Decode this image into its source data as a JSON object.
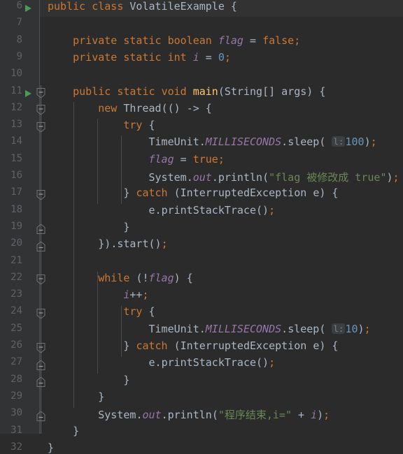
{
  "editor": {
    "language": "Java",
    "theme": "Darcula",
    "colors": {
      "background": "#2B2B2B",
      "gutter_background": "#313335",
      "gutter_border": "#4E5254",
      "line_number": "#606366",
      "caret_line": "#323232",
      "default_text": "#A9B7C6",
      "keyword": "#CC7832",
      "string": "#6A8759",
      "number": "#6897BB",
      "method": "#FFC66D",
      "static_field": "#9876AA",
      "run_marker": "#499C54",
      "indent_guide": "#4B4B4B",
      "inlay_hint_bg": "#3B3F41",
      "inlay_hint_text": "#7A7F82"
    },
    "first_visible_line": 6,
    "last_visible_line": 32
  },
  "gutter": {
    "line_numbers": [
      6,
      7,
      8,
      9,
      10,
      11,
      12,
      13,
      14,
      15,
      16,
      17,
      18,
      19,
      20,
      21,
      22,
      23,
      24,
      25,
      26,
      27,
      28,
      29,
      30,
      31,
      32
    ],
    "run_markers": [
      6,
      11
    ],
    "fold_markers": [
      {
        "line": 11,
        "direction": "down"
      },
      {
        "line": 12,
        "direction": "down"
      },
      {
        "line": 13,
        "direction": "down"
      },
      {
        "line": 17,
        "direction": "down"
      },
      {
        "line": 19,
        "direction": "up"
      },
      {
        "line": 20,
        "direction": "up"
      },
      {
        "line": 22,
        "direction": "down"
      },
      {
        "line": 24,
        "direction": "down"
      },
      {
        "line": 26,
        "direction": "down"
      },
      {
        "line": 28,
        "direction": "up"
      },
      {
        "line": 29,
        "direction": "up"
      },
      {
        "line": 31,
        "direction": "up"
      }
    ]
  },
  "code": {
    "lines": [
      {
        "n": 6,
        "text": "public class VolatileExample {"
      },
      {
        "n": 7,
        "text": ""
      },
      {
        "n": 8,
        "text": "    private static boolean flag = false;"
      },
      {
        "n": 9,
        "text": "    private static int i = 0;"
      },
      {
        "n": 10,
        "text": ""
      },
      {
        "n": 11,
        "text": "    public static void main(String[] args) {"
      },
      {
        "n": 12,
        "text": "        new Thread(() -> {"
      },
      {
        "n": 13,
        "text": "            try {"
      },
      {
        "n": 14,
        "text": "                TimeUnit.MILLISECONDS.sleep( l: 100);"
      },
      {
        "n": 15,
        "text": "                flag = true;"
      },
      {
        "n": 16,
        "text": "                System.out.println(\"flag 被修改成 true\");"
      },
      {
        "n": 17,
        "text": "            } catch (InterruptedException e) {"
      },
      {
        "n": 18,
        "text": "                e.printStackTrace();"
      },
      {
        "n": 19,
        "text": "            }"
      },
      {
        "n": 20,
        "text": "        }).start();"
      },
      {
        "n": 21,
        "text": ""
      },
      {
        "n": 22,
        "text": "        while (!flag) {"
      },
      {
        "n": 23,
        "text": "            i++;"
      },
      {
        "n": 24,
        "text": "            try {"
      },
      {
        "n": 25,
        "text": "                TimeUnit.MILLISECONDS.sleep( l: 10);"
      },
      {
        "n": 26,
        "text": "            } catch (InterruptedException e) {"
      },
      {
        "n": 27,
        "text": "                e.printStackTrace();"
      },
      {
        "n": 28,
        "text": "            }"
      },
      {
        "n": 29,
        "text": "        }"
      },
      {
        "n": 30,
        "text": "        System.out.println(\"程序结束,i=\" + i);"
      },
      {
        "n": 31,
        "text": "    }"
      },
      {
        "n": 32,
        "text": "}"
      }
    ],
    "inlay_hints": [
      {
        "line": 14,
        "label": "l:",
        "value": "100"
      },
      {
        "line": 25,
        "label": "l:",
        "value": "10"
      }
    ],
    "strings": [
      {
        "line": 16,
        "value": "flag 被修改成 true"
      },
      {
        "line": 30,
        "value": "程序结束,i="
      }
    ],
    "class_name": "VolatileExample",
    "fields": [
      "flag",
      "i"
    ],
    "method": "main"
  }
}
